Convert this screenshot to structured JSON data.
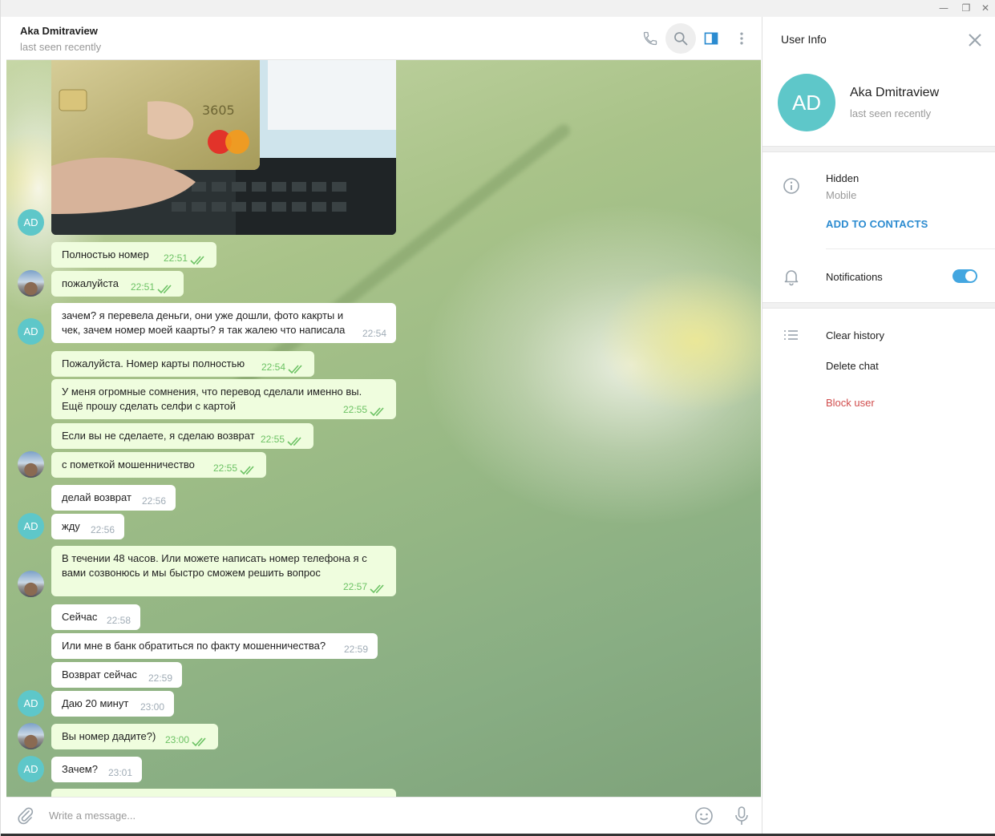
{
  "window": {
    "controls": {
      "minimize": "—",
      "maximize": "❐",
      "close": "✕"
    }
  },
  "chat_header": {
    "title": "Aka Dmitraview",
    "status": "last seen recently",
    "icons": [
      "phone-icon",
      "search-icon",
      "sidebar-toggle-icon",
      "more-icon"
    ]
  },
  "avatar_initials": "AD",
  "colors": {
    "accent": "#5ec7c9",
    "outgoing_bubble": "#effdde",
    "incoming_bubble": "#ffffff",
    "link": "#2b8bd0",
    "danger": "#d14e4e",
    "toggle": "#43a6e0"
  },
  "photo_card_number": "3605",
  "messages": [
    {
      "text": "Полностью номер",
      "time": "22:51",
      "side": "out"
    },
    {
      "text": "пожалуйста",
      "time": "22:51",
      "side": "out"
    },
    {
      "text": "зачем?  я перевела деньги, они уже дошли, фото какрты и  чек, зачем номер моей каарты? я так жалею что написала",
      "time": "22:54",
      "side": "in"
    },
    {
      "text": "Пожалуйста. Номер карты полностью",
      "time": "22:54",
      "side": "out"
    },
    {
      "text": "У меня огромные сомнения, что перевод сделали именно вы. Ещё прошу сделать селфи с картой",
      "time": "22:55",
      "side": "out"
    },
    {
      "text": "Если вы не сделаете, я сделаю возврат",
      "time": "22:55",
      "side": "out"
    },
    {
      "text": "с пометкой мошенничество",
      "time": "22:55",
      "side": "out"
    },
    {
      "text": "делай возврат",
      "time": "22:56",
      "side": "in"
    },
    {
      "text": "жду",
      "time": "22:56",
      "side": "in"
    },
    {
      "text": "В течении 48 часов. Или можете написать номер телефона я с вами созвонюсь и мы быстро сможем решить вопрос",
      "time": "22:57",
      "side": "out"
    },
    {
      "text": "Сейчас",
      "time": "22:58",
      "side": "in"
    },
    {
      "text": "Или мне в банк обратиться по факту мошенничества?",
      "time": "22:59",
      "side": "in"
    },
    {
      "text": "Возврат сейчас",
      "time": "22:59",
      "side": "in"
    },
    {
      "text": "Даю 20 минут",
      "time": "23:00",
      "side": "in"
    },
    {
      "text": "Вы номер дадите?)",
      "time": "23:00",
      "side": "out"
    },
    {
      "text": "Зачем?",
      "time": "23:01",
      "side": "in"
    }
  ],
  "input": {
    "placeholder": "Write a message...",
    "icons": [
      "attach-icon",
      "emoji-icon",
      "microphone-icon"
    ]
  },
  "panel": {
    "title": "User Info",
    "name": "Aka Dmitraview",
    "status": "last seen recently",
    "phone_label": "Hidden",
    "phone_sub": "Mobile",
    "add_contact": "ADD TO CONTACTS",
    "notifications": "Notifications",
    "notifications_on": true,
    "clear_history": "Clear history",
    "delete_chat": "Delete chat",
    "block_user": "Block user"
  }
}
